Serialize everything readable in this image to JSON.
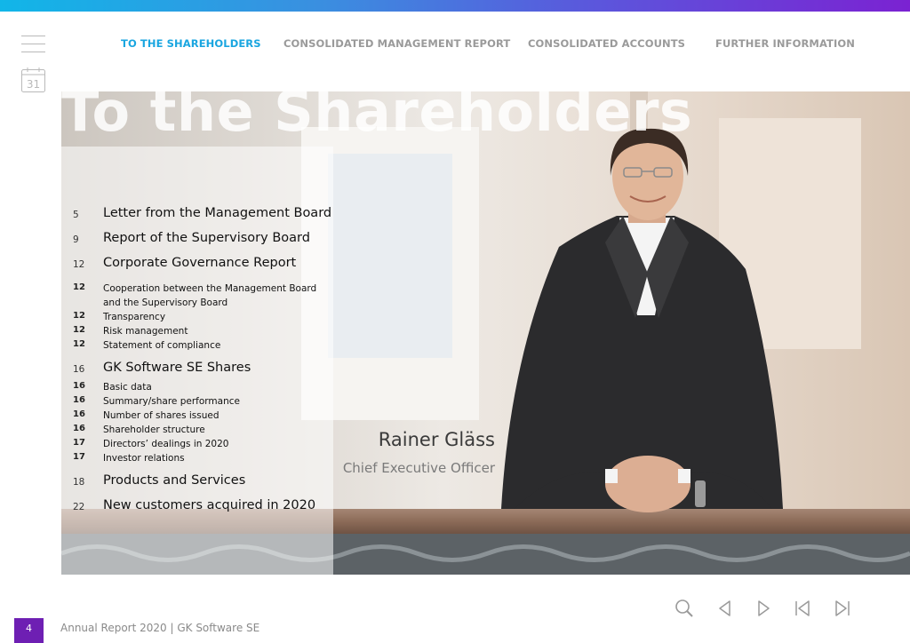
{
  "nav": {
    "items": [
      {
        "label": "TO THE SHAREHOLDERS",
        "active": true
      },
      {
        "label": "CONSOLIDATED MANAGEMENT REPORT",
        "active": false
      },
      {
        "label": "CONSOLIDATED ACCOUNTS",
        "active": false
      },
      {
        "label": "FURTHER INFORMATION",
        "active": false
      }
    ]
  },
  "calendar": {
    "day": "31"
  },
  "hero": {
    "title": "To the Shareholders",
    "person_name": "Rainer Gläss",
    "person_role": "Chief Executive Officer"
  },
  "toc": [
    {
      "page": "5",
      "label": "Letter from the Management Board"
    },
    {
      "page": "9",
      "label": "Report of the Supervisory Board"
    },
    {
      "page": "12",
      "label": "Corporate Governance Report"
    },
    {
      "page": "12",
      "label": "Cooperation between the Management Board"
    },
    {
      "page": "",
      "label": "and the Supervisory Board"
    },
    {
      "page": "12",
      "label": "Transparency"
    },
    {
      "page": "12",
      "label": "Risk management"
    },
    {
      "page": "12",
      "label": "Statement of compliance"
    },
    {
      "page": "16",
      "label": "GK Software SE Shares"
    },
    {
      "page": "16",
      "label": "Basic data"
    },
    {
      "page": "16",
      "label": "Summary/share performance"
    },
    {
      "page": "16",
      "label": "Number of shares issued"
    },
    {
      "page": "16",
      "label": "Shareholder structure"
    },
    {
      "page": "17",
      "label": "Directors’ dealings in 2020"
    },
    {
      "page": "17",
      "label": "Investor relations"
    },
    {
      "page": "18",
      "label": "Products and Services"
    },
    {
      "page": "22",
      "label": "New customers acquired in 2020"
    }
  ],
  "footer": {
    "page_number": "4",
    "text": "Annual Report 2020 | GK Software SE"
  },
  "controls": [
    "search-icon",
    "prev-page-icon",
    "next-page-icon",
    "first-page-icon",
    "last-page-icon"
  ],
  "colors": {
    "accent": "#1aa6e0",
    "badge": "#6e1fb3",
    "nav_inactive": "#9a9a9a"
  }
}
